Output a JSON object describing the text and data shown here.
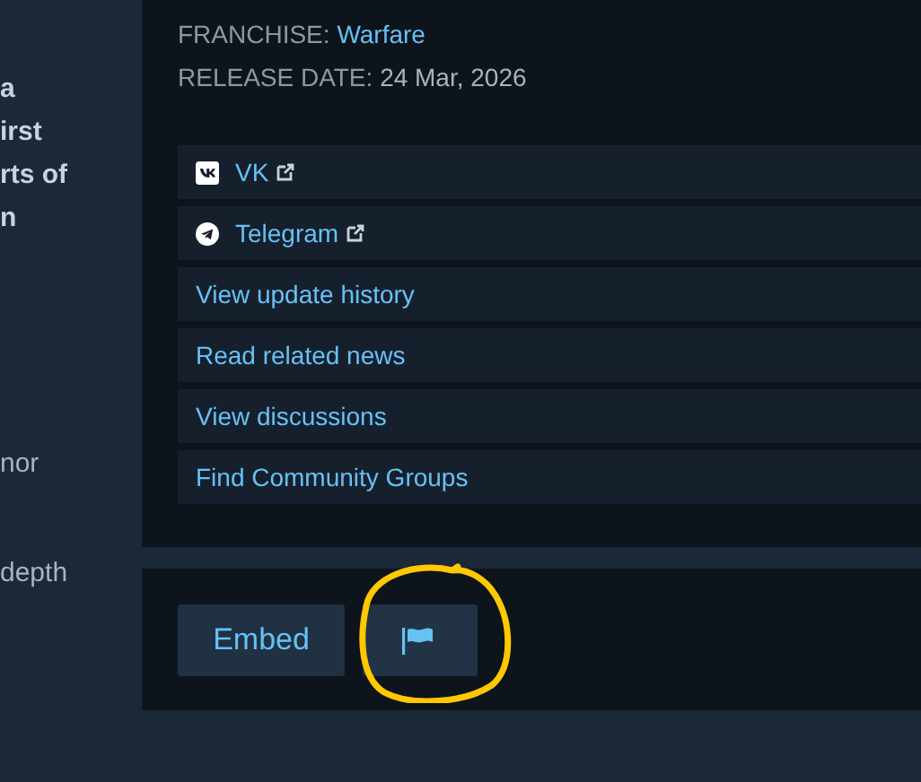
{
  "left_text": [
    {
      "text": "a",
      "kind": "bold"
    },
    {
      "text": "irst",
      "kind": "bold"
    },
    {
      "text": "rts of",
      "kind": "bold"
    },
    {
      "text": "n",
      "kind": "bold"
    },
    {
      "text": "nor",
      "kind": "plain"
    },
    {
      "text": "depth",
      "kind": "plain"
    }
  ],
  "details": [
    {
      "label": "FRANCHISE:",
      "value": "Warfare",
      "kind": "link"
    },
    {
      "label": "RELEASE DATE:",
      "value": "24 Mar, 2026",
      "kind": "plain"
    }
  ],
  "links": [
    {
      "label": "VK",
      "kind": "vk",
      "external": true
    },
    {
      "label": "Telegram",
      "kind": "telegram",
      "external": true
    },
    {
      "label": "View update history",
      "kind": "plain",
      "external": false
    },
    {
      "label": "Read related news",
      "kind": "plain",
      "external": false
    },
    {
      "label": "View discussions",
      "kind": "plain",
      "external": false
    },
    {
      "label": "Find Community Groups",
      "kind": "plain",
      "external": false
    }
  ],
  "buttons": [
    {
      "kind": "text",
      "label": "Embed"
    },
    {
      "kind": "flag",
      "highlighted": true
    }
  ]
}
